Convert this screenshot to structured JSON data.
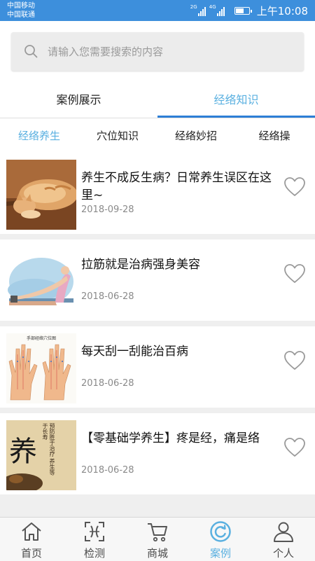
{
  "status": {
    "carrier1": "中国移动",
    "carrier2": "中国联通",
    "net1": "2G",
    "net2": "4G",
    "time": "上午10:08"
  },
  "search": {
    "placeholder": "请输入您需要搜索的内容"
  },
  "main_tabs": [
    {
      "label": "案例展示",
      "active": false
    },
    {
      "label": "经络知识",
      "active": true
    }
  ],
  "sub_tabs": [
    {
      "label": "经络养生",
      "active": true
    },
    {
      "label": "穴位知识",
      "active": false
    },
    {
      "label": "经络妙招",
      "active": false
    },
    {
      "label": "经络操",
      "active": false
    }
  ],
  "articles": [
    {
      "title": "养生不成反生病？日常养生误区在这里~",
      "date": "2018-09-28",
      "thumb": "cat-photo"
    },
    {
      "title": "拉筋就是治病强身美容",
      "date": "2018-06-28",
      "thumb": "stretching-illustration"
    },
    {
      "title": "每天刮一刮能治百病",
      "date": "2018-06-28",
      "thumb": "hand-acupoint-chart"
    },
    {
      "title": "【零基础学养生】疼是经，痛是络",
      "date": "2018-06-28",
      "thumb": "calligraphy-yang"
    }
  ],
  "thumb_text": {
    "calligraphy_big": "养",
    "calligraphy_small": "预防胜于治疗 养生等于长寿",
    "chart_caption": "手部经络穴位图"
  },
  "bottom_nav": [
    {
      "label": "首页",
      "icon": "home-icon",
      "active": false
    },
    {
      "label": "检测",
      "icon": "scan-icon",
      "active": false
    },
    {
      "label": "商城",
      "icon": "cart-icon",
      "active": false
    },
    {
      "label": "案例",
      "icon": "case-icon",
      "active": true
    },
    {
      "label": "个人",
      "icon": "person-icon",
      "active": false
    }
  ],
  "colors": {
    "status_bar": "#3d8fdc",
    "accent": "#5ab0e0",
    "tab_indicator": "#2d7fd6",
    "background": "#efefef"
  }
}
